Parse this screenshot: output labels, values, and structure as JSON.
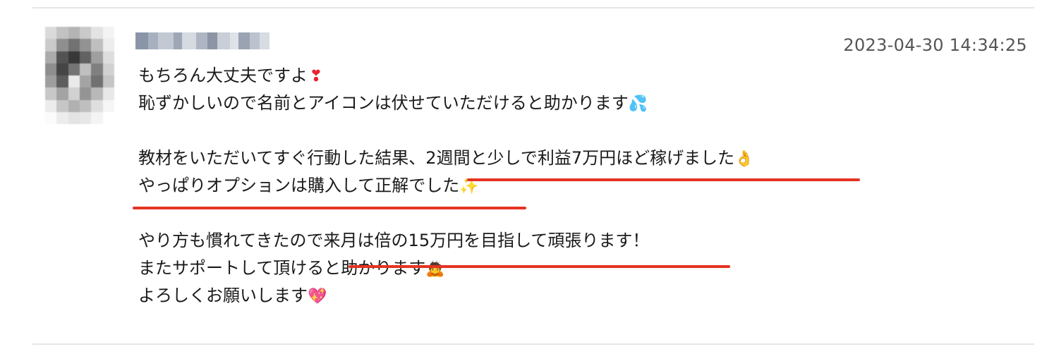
{
  "comment": {
    "timestamp": "2023-04-30 14:34:25",
    "lines": [
      {
        "text": "もちろん大丈夫ですよ",
        "emoji": "❣"
      },
      {
        "text": "恥ずかしいので名前とアイコンは伏せていただけると助かります",
        "emoji": "💦"
      },
      {
        "text": "",
        "emoji": ""
      },
      {
        "text": "教材をいただいてすぐ行動した結果、2週間と少しで利益7万円ほど稼げました",
        "emoji": "👌"
      },
      {
        "text": "やっぱりオプションは購入して正解でした",
        "emoji": "✨"
      },
      {
        "text": "",
        "emoji": ""
      },
      {
        "text": "やり方も慣れてきたので来月は倍の15万円を目指して頑張ります！",
        "emoji": ""
      },
      {
        "text": "またサポートして頂けると助かります",
        "emoji": "🙇"
      },
      {
        "text": "よろしくお願いします",
        "emoji": "💖"
      }
    ]
  },
  "colors": {
    "underline": "#e53322",
    "timestamp": "#555555",
    "text": "#1a1a1a",
    "divider": "#e6e6e6"
  },
  "icons": {
    "avatar": "blurred-avatar-icon",
    "username": "blurred-username"
  }
}
